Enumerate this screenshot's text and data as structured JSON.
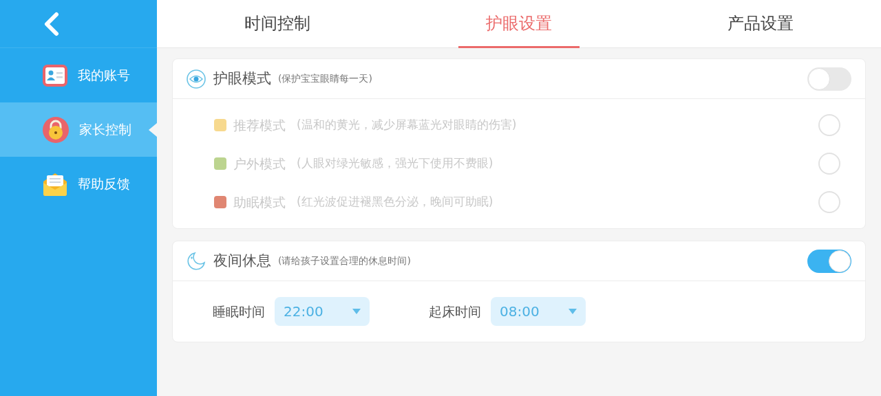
{
  "sidebar": {
    "items": [
      {
        "label": "我的账号",
        "kind": "account",
        "selected": false
      },
      {
        "label": "家长控制",
        "kind": "parental",
        "selected": true
      },
      {
        "label": "帮助反馈",
        "kind": "feedback",
        "selected": false
      }
    ]
  },
  "tabs": [
    {
      "label": "时间控制",
      "selected": false
    },
    {
      "label": "护眼设置",
      "selected": true
    },
    {
      "label": "产品设置",
      "selected": false
    }
  ],
  "eye_mode": {
    "title": "护眼模式",
    "subtitle": "(保护宝宝眼睛每一天)",
    "on": false,
    "modes": [
      {
        "name": "推荐模式",
        "description": "(温和的黄光，减少屏幕蓝光对眼睛的伤害)",
        "color": "#f7d98e",
        "disabled": true,
        "selected": false
      },
      {
        "name": "户外模式",
        "description": "(人眼对绿光敏感，强光下使用不费眼)",
        "color": "#bcd48f",
        "disabled": true,
        "selected": false
      },
      {
        "name": "助眠模式",
        "description": "(红光波促进褪黑色分泌，晚间可助眠)",
        "color": "#e08672",
        "disabled": true,
        "selected": false
      }
    ]
  },
  "night_rest": {
    "title": "夜间休息",
    "subtitle": "(请给孩子设置合理的休息时间)",
    "on": true,
    "times": [
      {
        "label": "睡眠时间",
        "value": "22:00"
      },
      {
        "label": "起床时间",
        "value": "08:00"
      }
    ]
  }
}
